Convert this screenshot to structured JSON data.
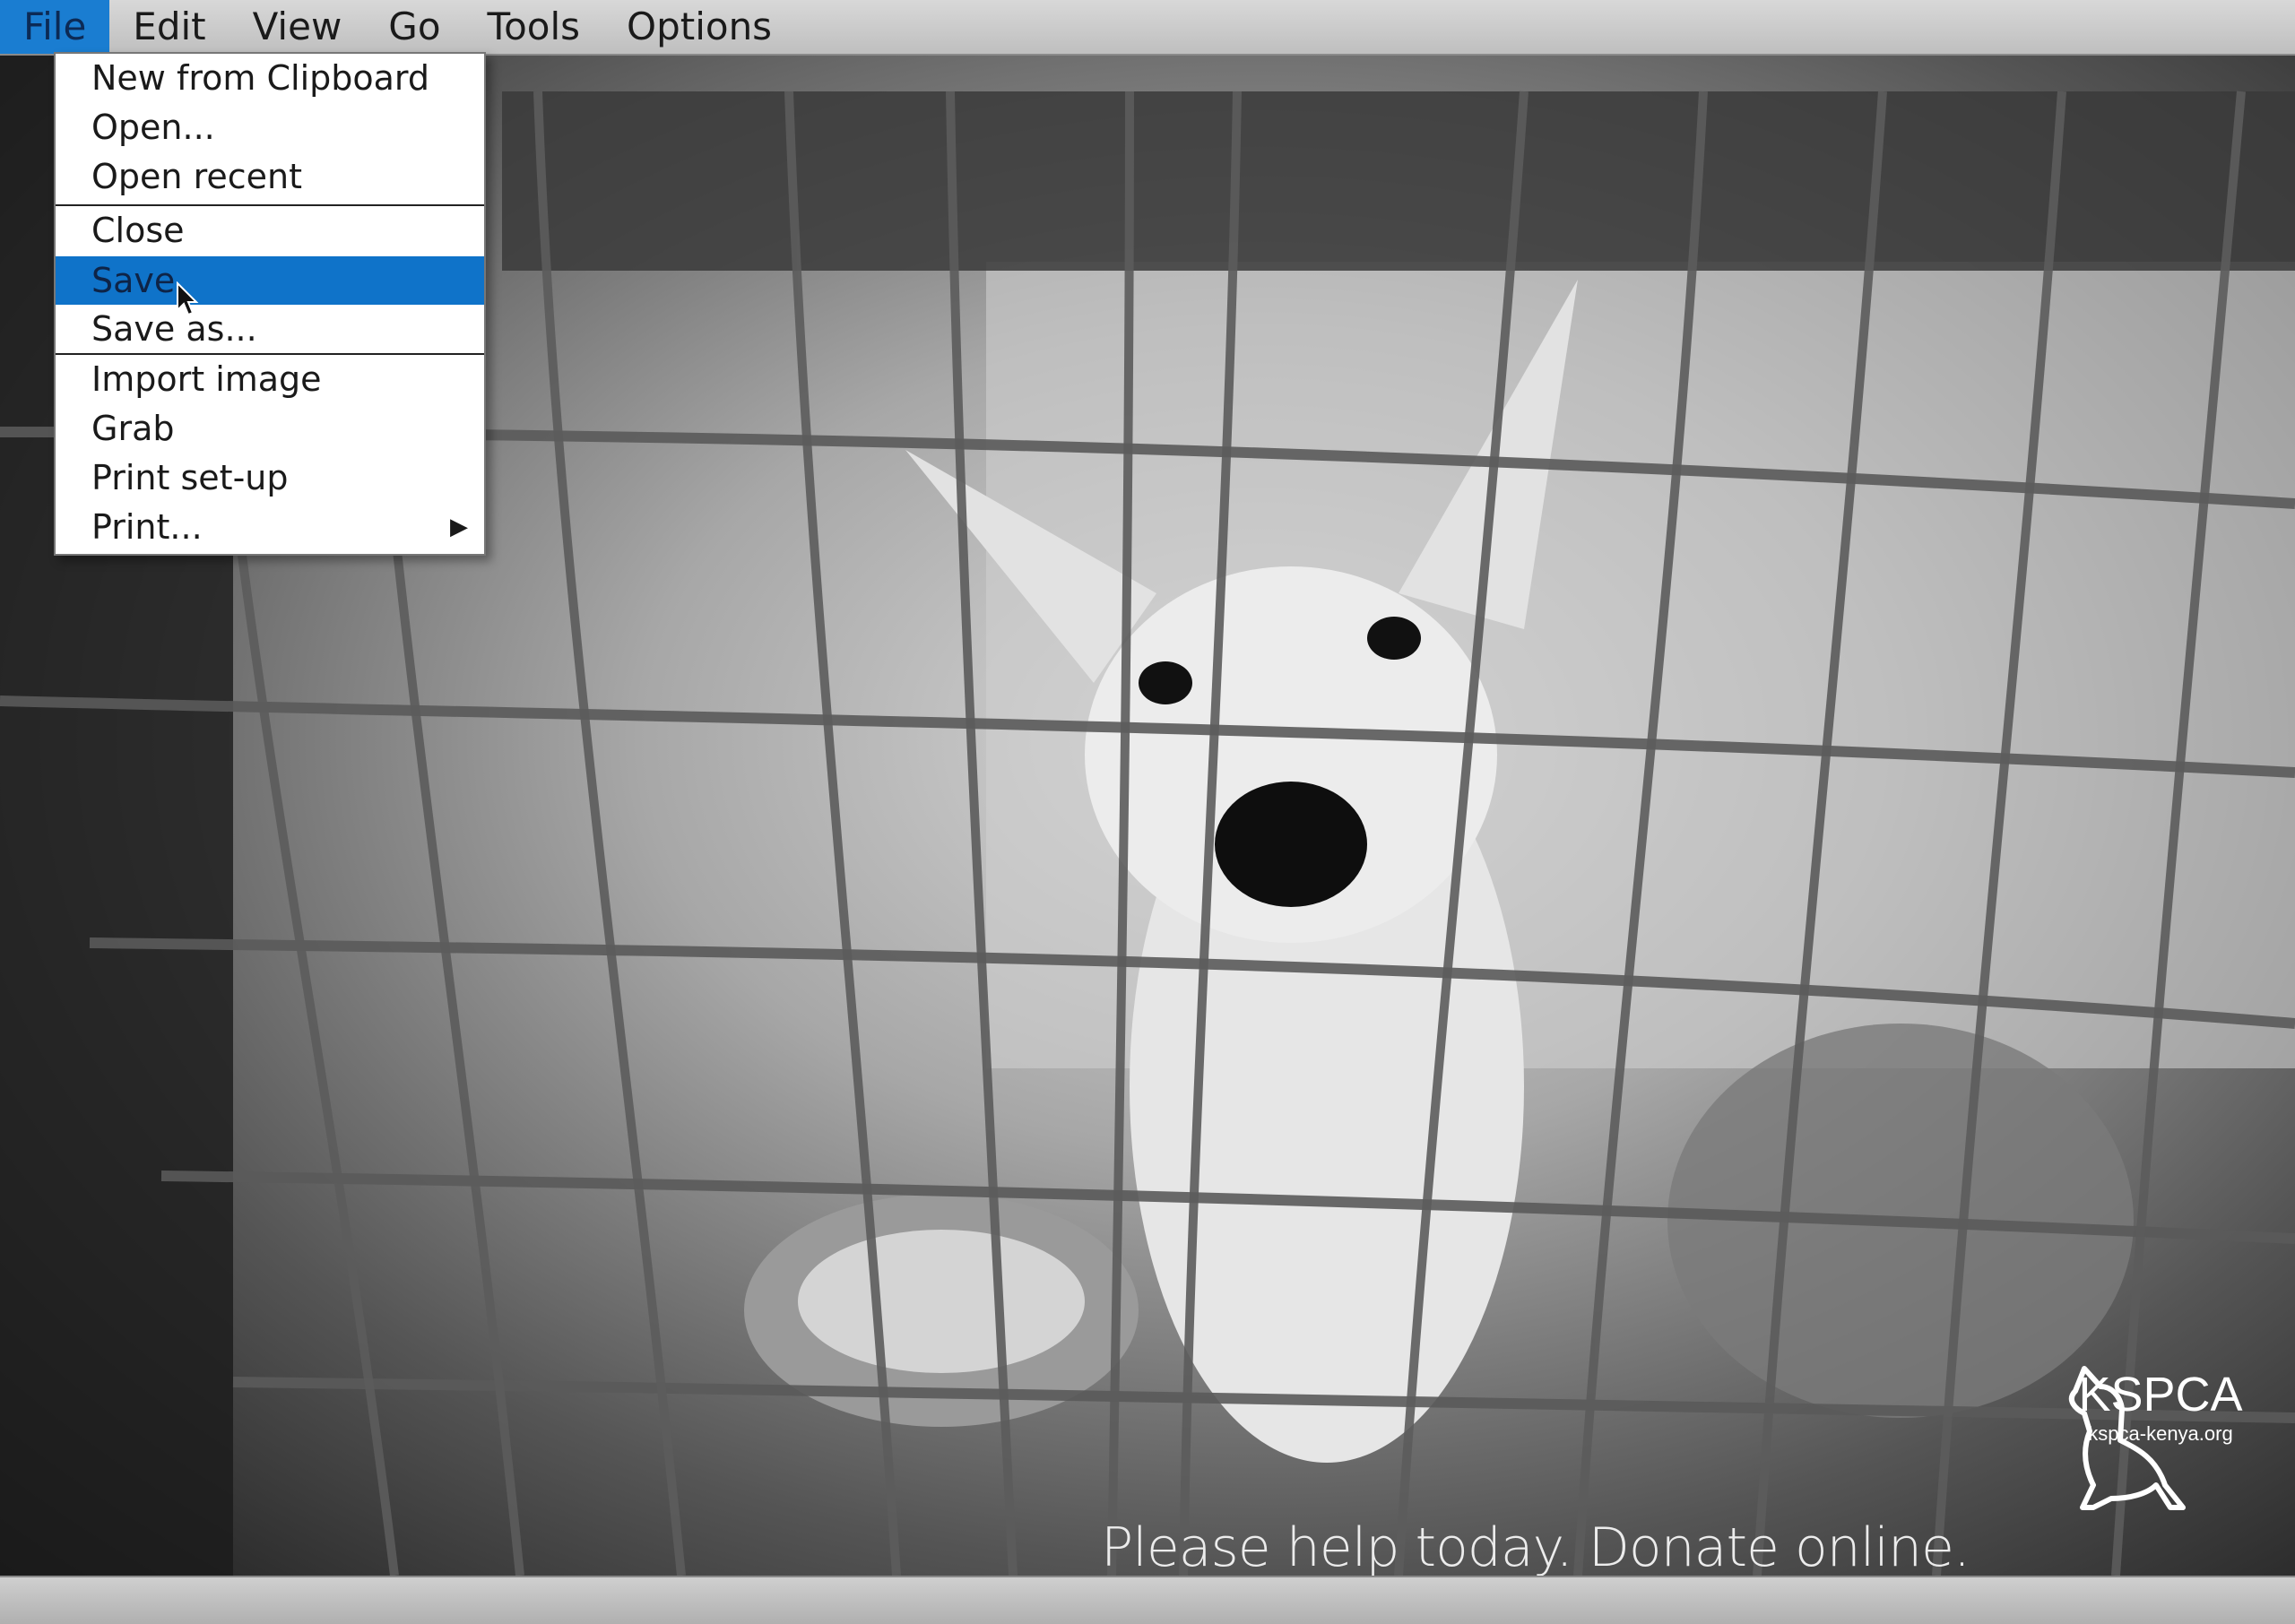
{
  "menubar": {
    "items": [
      {
        "label": "File",
        "active": true
      },
      {
        "label": "Edit"
      },
      {
        "label": "View"
      },
      {
        "label": "Go"
      },
      {
        "label": "Tools"
      },
      {
        "label": "Options"
      }
    ]
  },
  "file_menu": {
    "items": [
      {
        "label": "New from Clipboard"
      },
      {
        "label": "Open..."
      },
      {
        "label": "Open recent"
      },
      {
        "label": "Close"
      },
      {
        "label": "Save",
        "highlighted": true
      },
      {
        "label": "Save as..."
      },
      {
        "label": "Import image"
      },
      {
        "label": "Grab"
      },
      {
        "label": "Print set-up"
      },
      {
        "label": "Print...",
        "has_submenu": true
      }
    ],
    "submenu_arrow": "▶"
  },
  "ad": {
    "slogan": "Please help today. Donate online.",
    "brand": "KSPCA",
    "url": "kspca-kenya.org"
  },
  "colors": {
    "menu_highlight": "#0f73c9",
    "menubar_bg": "#c9c9c9"
  },
  "icons": {
    "cursor": "arrow-pointer-icon",
    "logo": "dog-cat-silhouette-icon"
  }
}
